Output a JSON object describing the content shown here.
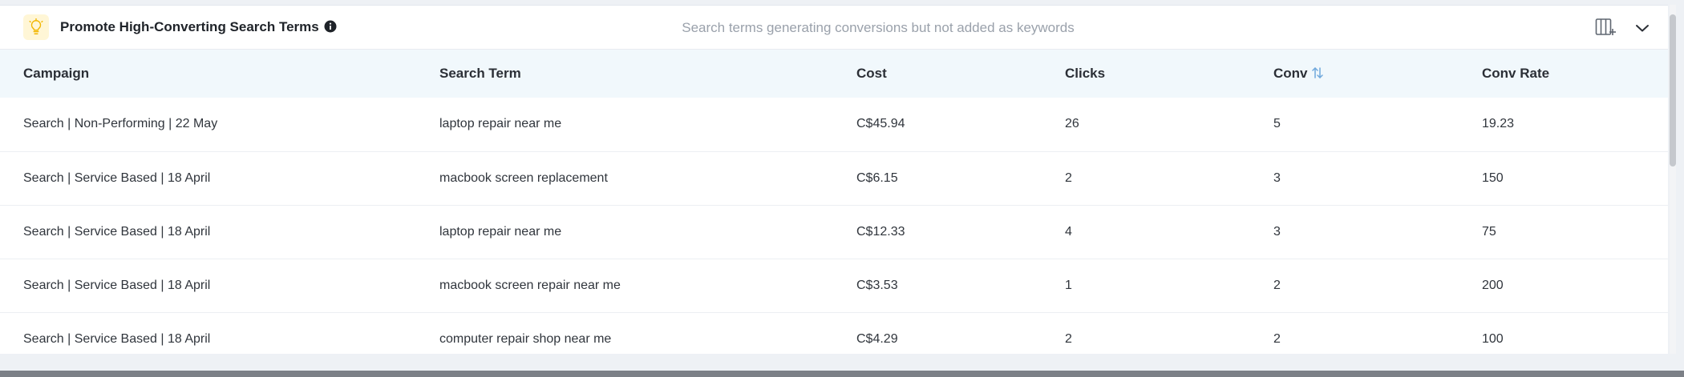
{
  "card": {
    "title": "Promote High-Converting Search Terms",
    "subtitle": "Search terms generating conversions but not added as keywords"
  },
  "icons": {
    "lightbulb": "lightbulb-icon",
    "info": "info-icon",
    "columns": "columns-settings-icon",
    "collapse": "chevron-down-icon",
    "sort": "sort-icon"
  },
  "colors": {
    "accent_bulb": "#f2b600",
    "header_row_bg": "#f1f8fc",
    "subtitle_text": "#9aa1ab",
    "sort_icon": "#6fa8dc"
  },
  "table": {
    "columns": [
      "Campaign",
      "Search Term",
      "Cost",
      "Clicks",
      "Conv",
      "Conv Rate"
    ],
    "rows": [
      [
        "Search | Non-Performing | 22 May",
        "laptop repair near me",
        "C$45.94",
        "26",
        "5",
        "19.23"
      ],
      [
        "Search | Service Based | 18 April",
        "macbook screen replacement",
        "C$6.15",
        "2",
        "3",
        "150"
      ],
      [
        "Search | Service Based | 18 April",
        "laptop repair near me",
        "C$12.33",
        "4",
        "3",
        "75"
      ],
      [
        "Search | Service Based | 18 April",
        "macbook screen repair near me",
        "C$3.53",
        "1",
        "2",
        "200"
      ],
      [
        "Search | Service Based | 18 April",
        "computer repair shop near me",
        "C$4.29",
        "2",
        "2",
        "100"
      ]
    ]
  }
}
